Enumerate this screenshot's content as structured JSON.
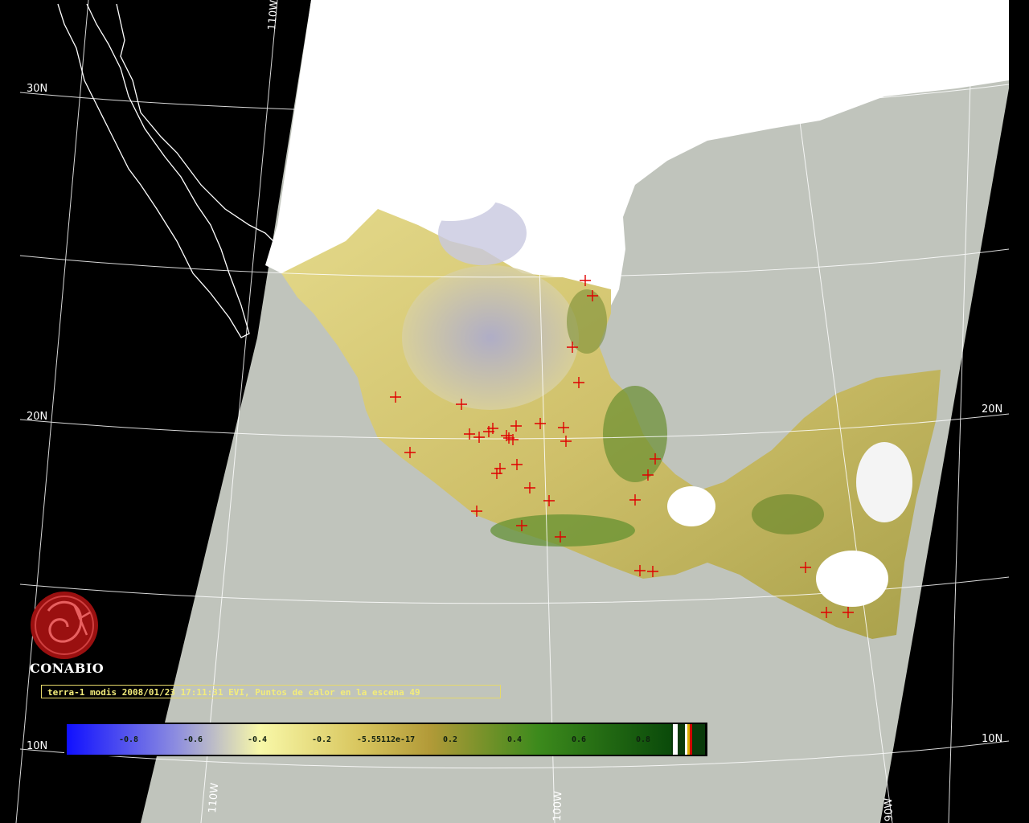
{
  "graticule": {
    "lat_labels_left": [
      "30N",
      "20N",
      "10N"
    ],
    "lat_labels_right": [
      "20N",
      "10N"
    ],
    "lon_labels_top": [
      "110W"
    ],
    "lon_labels_bottom": [
      "110W",
      "100W",
      "90W"
    ]
  },
  "logo": {
    "name": "CONABIO",
    "icon": "conabio-seal-icon"
  },
  "caption": "terra-1 modis 2008/01/23 17:11:31 EVI, Puntos de calor en la escena 49",
  "colorbar": {
    "ticks": [
      "-0.8",
      "-0.6",
      "-0.4",
      "-0.2",
      "-5.55112e-17",
      "0.2",
      "0.4",
      "0.6",
      "0.8"
    ],
    "colors": [
      "#1010ff",
      "#8c8ce0",
      "#f8f8a8",
      "#d9c760",
      "#b29a38",
      "#3c8a1c",
      "#0a4a0a"
    ]
  },
  "map_colors": {
    "ocean": "#c0c4bc",
    "outside": "#000000",
    "cloud": "#ffffff",
    "land_low": "#d8cc78",
    "land_high": "#5a8a30",
    "bare": "#b0b0d8",
    "hotspot": "#e00000"
  },
  "hotspots": {
    "count": 49
  }
}
